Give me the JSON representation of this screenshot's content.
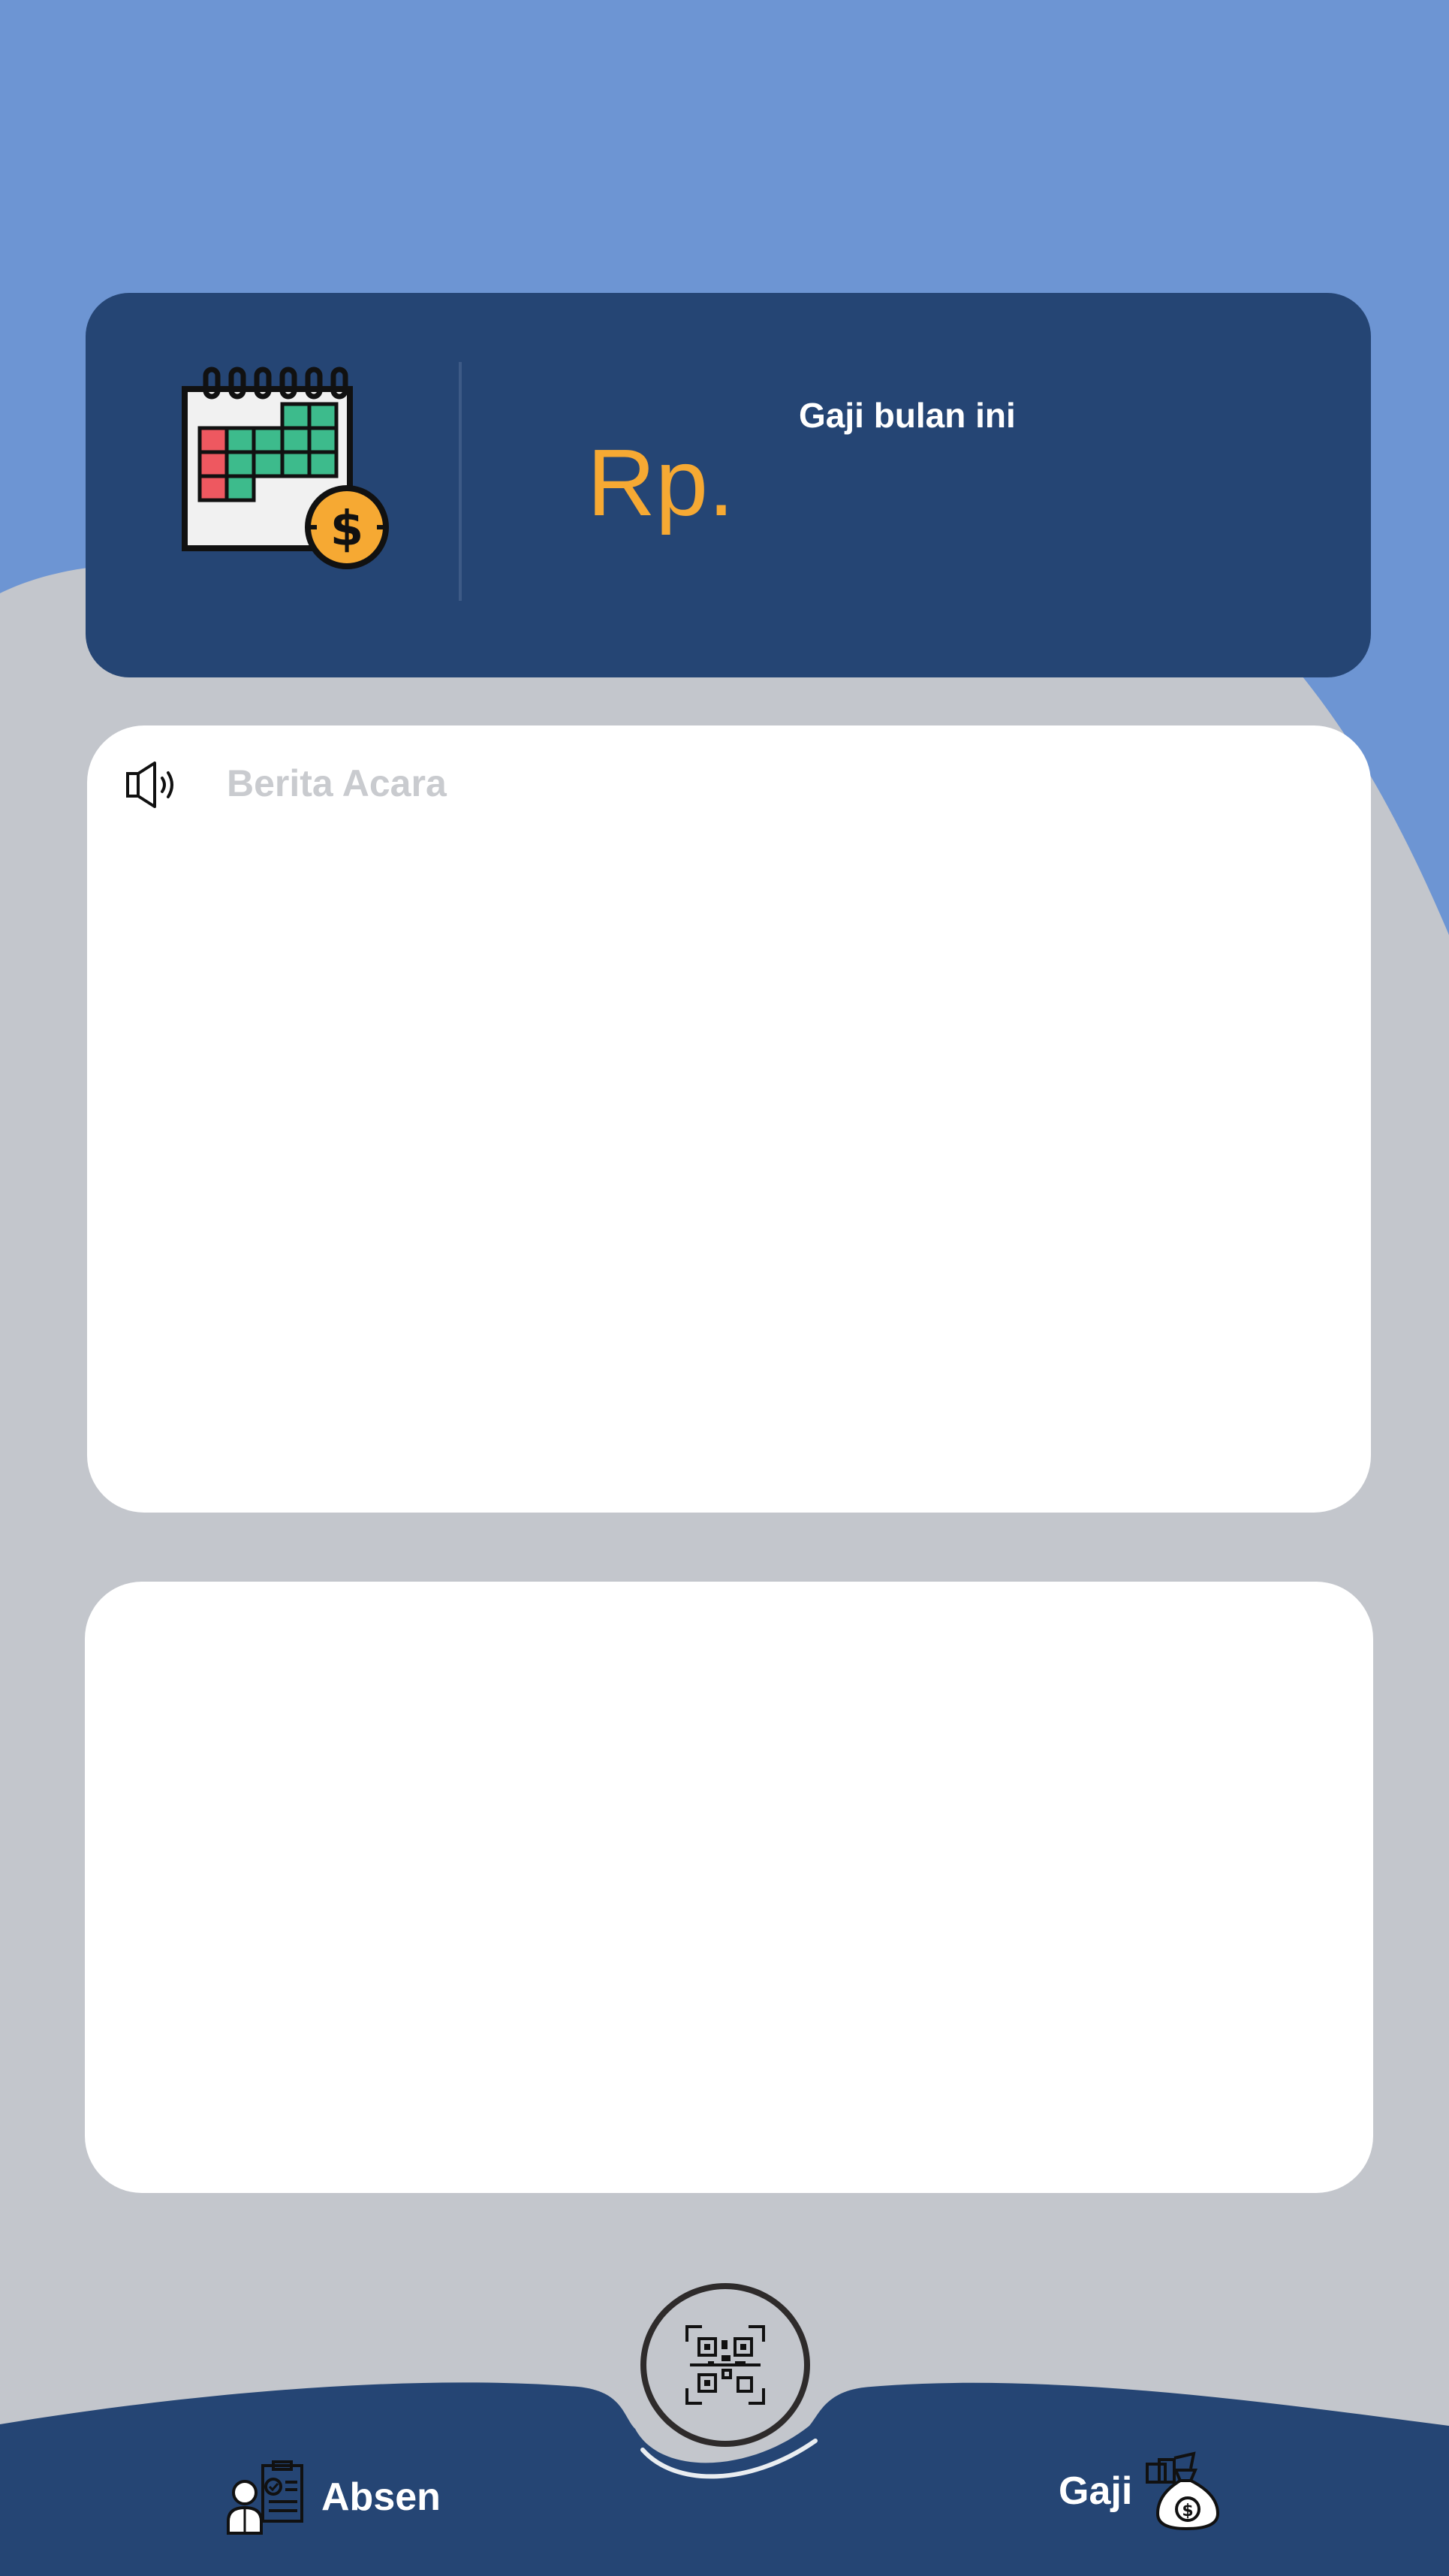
{
  "salary": {
    "label": "Gaji bulan ini",
    "currency": "Rp."
  },
  "news": {
    "title": "Berita Acara"
  },
  "bottom_nav": {
    "absen_label": "Absen",
    "gaji_label": "Gaji",
    "scan_icon": "qr-scan-icon"
  },
  "icons": {
    "salary_card": "calendar-dollar-icon",
    "news": "speaker-icon",
    "absen": "attendance-clipboard-icon",
    "gaji": "money-bag-icon"
  },
  "colors": {
    "header_blue": "#6d95d3",
    "navy": "#254574",
    "background_gray": "#c3c6cc",
    "accent_orange": "#f6a933",
    "white": "#ffffff"
  }
}
